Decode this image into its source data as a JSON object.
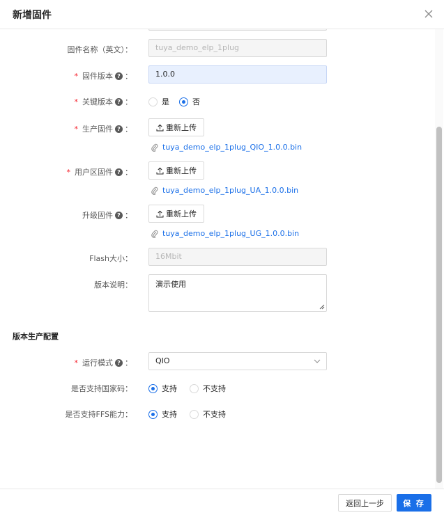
{
  "dialog": {
    "title": "新增固件"
  },
  "form": {
    "name_en": {
      "label": "固件名称（英文）：",
      "value": "tuya_demo_elp_1plug"
    },
    "version": {
      "label": "固件版本",
      "value": "1.0.0"
    },
    "key_version": {
      "label": "关键版本",
      "options": [
        "是",
        "否"
      ],
      "selected": "否"
    },
    "production_fw": {
      "label": "生产固件",
      "button": "重新上传",
      "file": "tuya_demo_elp_1plug_QIO_1.0.0.bin"
    },
    "user_fw": {
      "label": "用户区固件",
      "button": "重新上传",
      "file": "tuya_demo_elp_1plug_UA_1.0.0.bin"
    },
    "upgrade_fw": {
      "label": "升级固件",
      "button": "重新上传",
      "file": "tuya_demo_elp_1plug_UG_1.0.0.bin"
    },
    "flash": {
      "label": "Flash大小：",
      "value": "16Mbit"
    },
    "notes": {
      "label": "版本说明：",
      "value": "演示使用"
    }
  },
  "production": {
    "section_title": "版本生产配置",
    "run_mode": {
      "label": "运行模式",
      "value": "QIO"
    },
    "country_code": {
      "label": "是否支持国家码：",
      "options": [
        "支持",
        "不支持"
      ],
      "selected": "支持"
    },
    "ffs": {
      "label": "是否支持FFS能力：",
      "options": [
        "支持",
        "不支持"
      ],
      "selected": "支持"
    }
  },
  "footer": {
    "back": "返回上一步",
    "save": "保 存"
  },
  "colors": {
    "primary": "#1a6fe8",
    "required": "#f5222d"
  }
}
